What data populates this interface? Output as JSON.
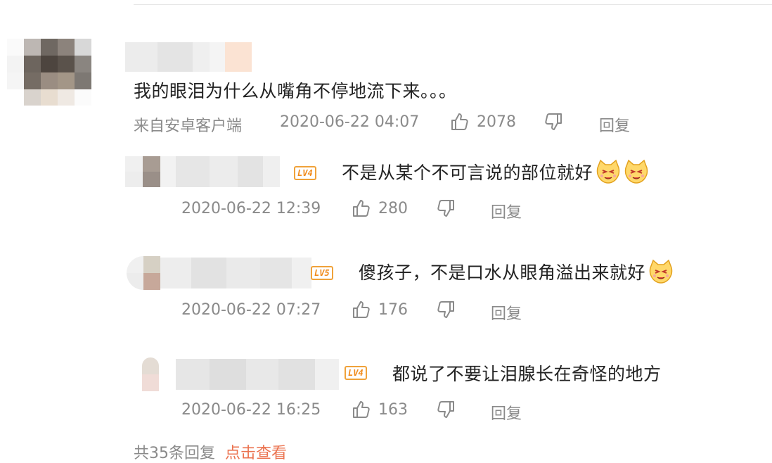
{
  "main_comment": {
    "text": "我的眼泪为什么从嘴角不停地流下来。。。",
    "source": "来自安卓客户端",
    "timestamp": "2020-06-22 04:07",
    "likes": "2078",
    "reply_label": "回复"
  },
  "replies": [
    {
      "level_badge": "LV4",
      "text": "不是从某个不可言说的部位就好",
      "emoji_count": 2,
      "timestamp": "2020-06-22 12:39",
      "likes": "280",
      "reply_label": "回复"
    },
    {
      "level_badge": "LV5",
      "text": "傻孩子，不是口水从眼角溢出来就好",
      "emoji_count": 1,
      "timestamp": "2020-06-22 07:27",
      "likes": "176",
      "reply_label": "回复"
    },
    {
      "level_badge": "LV4",
      "text": "都说了不要让泪腺长在奇怪的地方",
      "emoji_count": 0,
      "timestamp": "2020-06-22 16:25",
      "likes": "163",
      "reply_label": "回复"
    }
  ],
  "footer": {
    "text": "共35条回复",
    "link": "点击查看"
  },
  "icons": [
    "thumbs-up-icon",
    "thumbs-down-icon",
    "cat-face-emoji"
  ],
  "colors": {
    "badge": "#f0a23a",
    "meta_text": "#8a8a8a",
    "link": "#eb7350"
  }
}
